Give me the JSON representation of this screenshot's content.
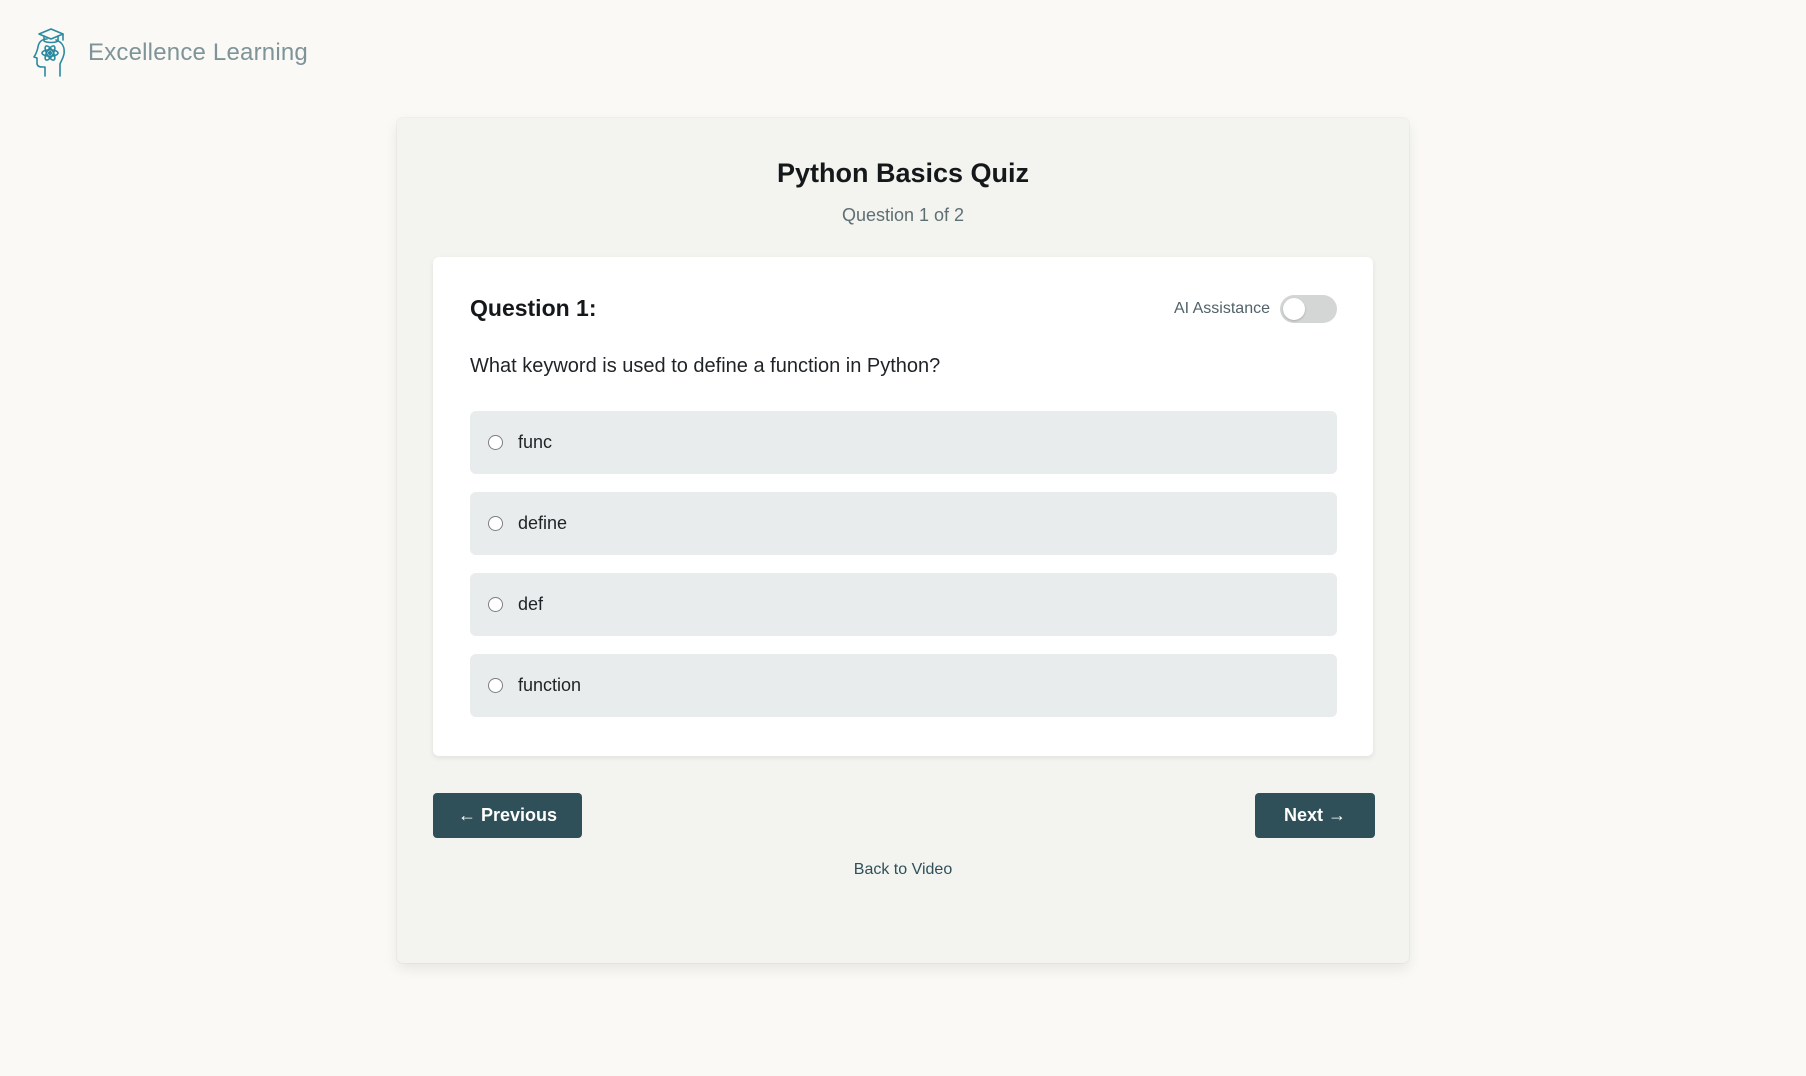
{
  "brand": {
    "name": "Excellence Learning",
    "logo_icon": "graduate-head-atom-icon"
  },
  "quiz": {
    "title": "Python Basics Quiz",
    "progress": "Question 1 of 2"
  },
  "question": {
    "label": "Question 1:",
    "text": "What keyword is used to define a function in Python?",
    "ai_assistance_label": "AI Assistance",
    "ai_assistance_enabled": false,
    "options": [
      {
        "label": "func",
        "selected": false
      },
      {
        "label": "define",
        "selected": false
      },
      {
        "label": "def",
        "selected": false
      },
      {
        "label": "function",
        "selected": false
      }
    ]
  },
  "navigation": {
    "previous_label": "← Previous",
    "next_label": "Next →",
    "back_label": "Back to Video"
  },
  "colors": {
    "page_background": "#faf9f5",
    "panel_background": "#f3f3ef",
    "button": "#2f5059",
    "option_background": "#e9ecec",
    "brand_text": "#7e9498",
    "logo": "#2b8aa0"
  }
}
